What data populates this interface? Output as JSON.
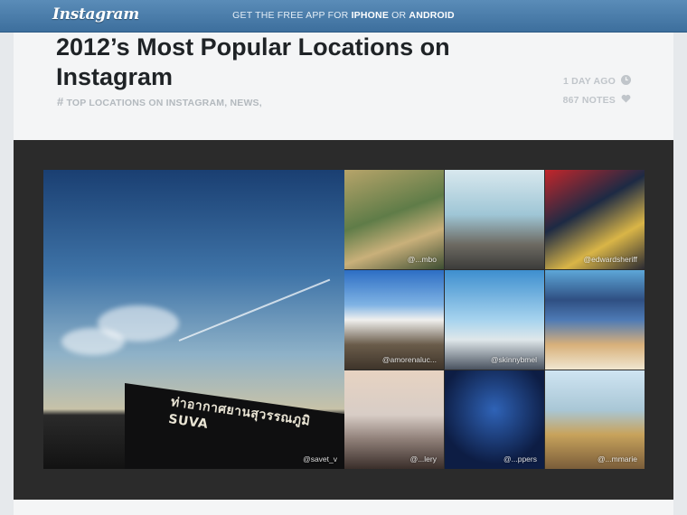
{
  "topbar": {
    "logo": "Instagram",
    "promo_prefix": "GET THE FREE APP FOR ",
    "promo_iphone": "IPHONE",
    "promo_or": " OR ",
    "promo_android": "ANDROID"
  },
  "post": {
    "title": "2012’s Most Popular Locations on Instagram",
    "tags": [
      "TOP LOCATIONS ON INSTAGRAM",
      "NEWS"
    ],
    "time": "1 DAY AGO",
    "notes": "867 NOTES"
  },
  "photos": {
    "big_caption": "@savet_v",
    "big_sign_text": "ท่าอากาศยานสุวรรณภูมิ SUVA",
    "tiles": [
      {
        "caption": "@...mbo"
      },
      {
        "caption": ""
      },
      {
        "caption": "@edwardsheriff"
      },
      {
        "caption": "@amorenaluc..."
      },
      {
        "caption": "@skinnybmel"
      },
      {
        "caption": ""
      },
      {
        "caption": "@...lery"
      },
      {
        "caption": "@...ppers"
      },
      {
        "caption": "@...mmarie"
      }
    ]
  },
  "colors": {
    "topbar": "#4a7eab",
    "panel": "#2b2b2b",
    "card": "#f4f5f6"
  }
}
